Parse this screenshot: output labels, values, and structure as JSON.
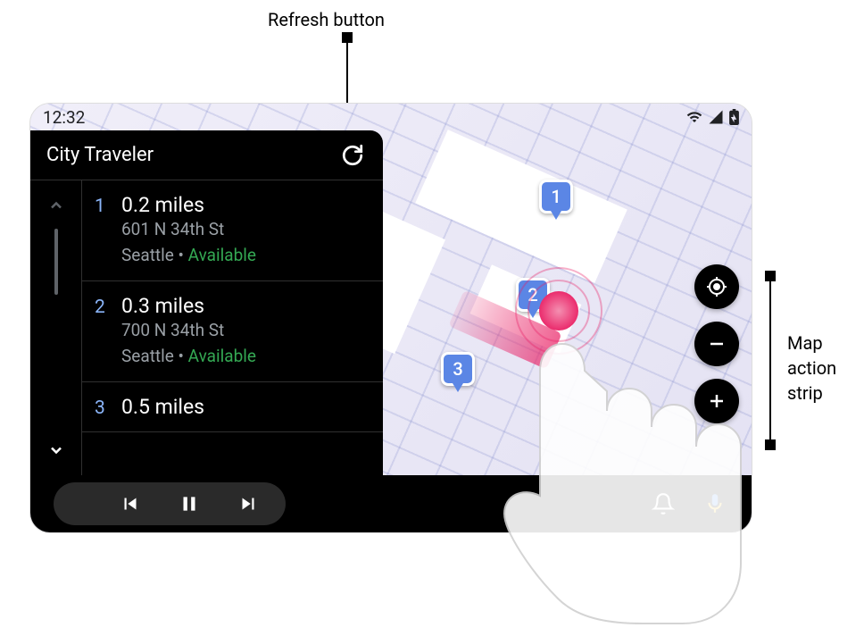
{
  "annotations": {
    "refresh": "Refresh button",
    "strip_l1": "Map",
    "strip_l2": "action",
    "strip_l3": "strip"
  },
  "status": {
    "time": "12:32"
  },
  "panel": {
    "title": "City Traveler"
  },
  "list": [
    {
      "num": "1",
      "distance": "0.2 miles",
      "address": "601 N 34th St",
      "city": "Seattle",
      "availability": "Available"
    },
    {
      "num": "2",
      "distance": "0.3 miles",
      "address": "700 N 34th St",
      "city": "Seattle",
      "availability": "Available"
    },
    {
      "num": "3",
      "distance": "0.5 miles",
      "address": "",
      "city": "",
      "availability": ""
    }
  ],
  "pins": {
    "p1": "1",
    "p2": "2",
    "p3": "3"
  },
  "icons": {
    "refresh": "refresh",
    "locate": "locate",
    "zoom_out": "minus",
    "zoom_in": "plus",
    "prev": "skip-previous",
    "pause": "pause",
    "next": "skip-next",
    "bell": "bell",
    "mic": "mic",
    "wifi": "wifi",
    "signal": "signal",
    "battery": "battery"
  },
  "colors": {
    "accent_blue": "#8ab4f8",
    "available_green": "#34a853",
    "spotify_green": "#1db954",
    "pin_blue": "#5b86e5",
    "touch_pink": "#e91e63"
  }
}
